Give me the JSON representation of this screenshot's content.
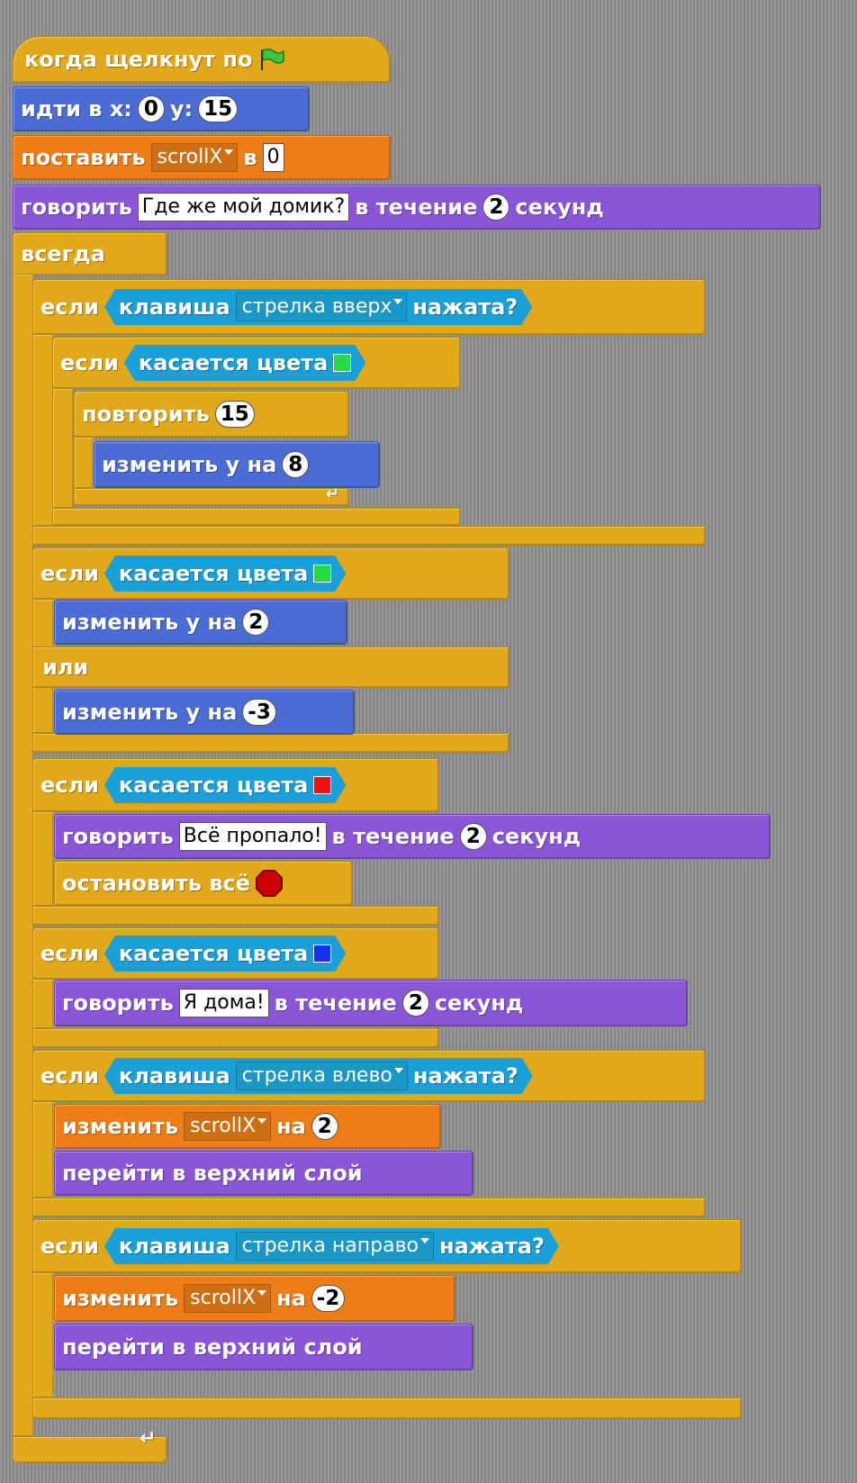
{
  "hat": {
    "label": "когда щелкнут по"
  },
  "goto": {
    "label": "идти в x:",
    "x": "0",
    "ylabel": "y:",
    "y": "15"
  },
  "setvar": {
    "label": "поставить",
    "var": "scrollX",
    "tolabel": "в",
    "value": "0"
  },
  "say1": {
    "label": "говорить",
    "text": "Где же мой домик?",
    "for": "в течение",
    "secs": "2",
    "unit": "секунд"
  },
  "forever": {
    "label": "всегда"
  },
  "if1": {
    "label": "если",
    "sensor": "клавиша",
    "key": "стрелка вверх",
    "pressed": "нажата?"
  },
  "if1a": {
    "label": "если",
    "sensor": "касается цвета",
    "color": "#22dd44"
  },
  "repeat": {
    "label": "повторить",
    "count": "15"
  },
  "change1": {
    "label": "изменить y на",
    "value": "8"
  },
  "if2": {
    "label": "если",
    "sensor": "касается цвета",
    "color": "#22dd44"
  },
  "change2": {
    "label": "изменить y на",
    "value": "2"
  },
  "else": {
    "label": "или"
  },
  "change3": {
    "label": "изменить y на",
    "value": "-3"
  },
  "if3": {
    "label": "если",
    "sensor": "касается цвета",
    "color": "#ee1111"
  },
  "say2": {
    "label": "говорить",
    "text": "Всё пропало!",
    "for": "в течение",
    "secs": "2",
    "unit": "секунд"
  },
  "stopall": {
    "label": "остановить всё"
  },
  "if4": {
    "label": "если",
    "sensor": "касается цвета",
    "color": "#1133ee"
  },
  "say3": {
    "label": "говорить",
    "text": "Я дома!",
    "for": "в течение",
    "secs": "2",
    "unit": "секунд"
  },
  "if5": {
    "label": "если",
    "sensor": "клавиша",
    "key": "стрелка влево",
    "pressed": "нажата?"
  },
  "chg1": {
    "label": "изменить",
    "var": "scrollX",
    "by": "на",
    "value": "2"
  },
  "front1": {
    "label": "перейти в верхний слой"
  },
  "if6": {
    "label": "если",
    "sensor": "клавиша",
    "key": "стрелка направо",
    "pressed": "нажата?"
  },
  "chg2": {
    "label": "изменить",
    "var": "scrollX",
    "by": "на",
    "value": "-2"
  },
  "front2": {
    "label": "перейти в верхний слой"
  },
  "colors": {
    "control": "#e1a91a",
    "motion": "#4a6cd4",
    "variables": "#ee7d16",
    "looks": "#8a55d7",
    "sensing": "#1aa0d8",
    "flag": "#3ec63e",
    "stop": "#cc0000"
  }
}
